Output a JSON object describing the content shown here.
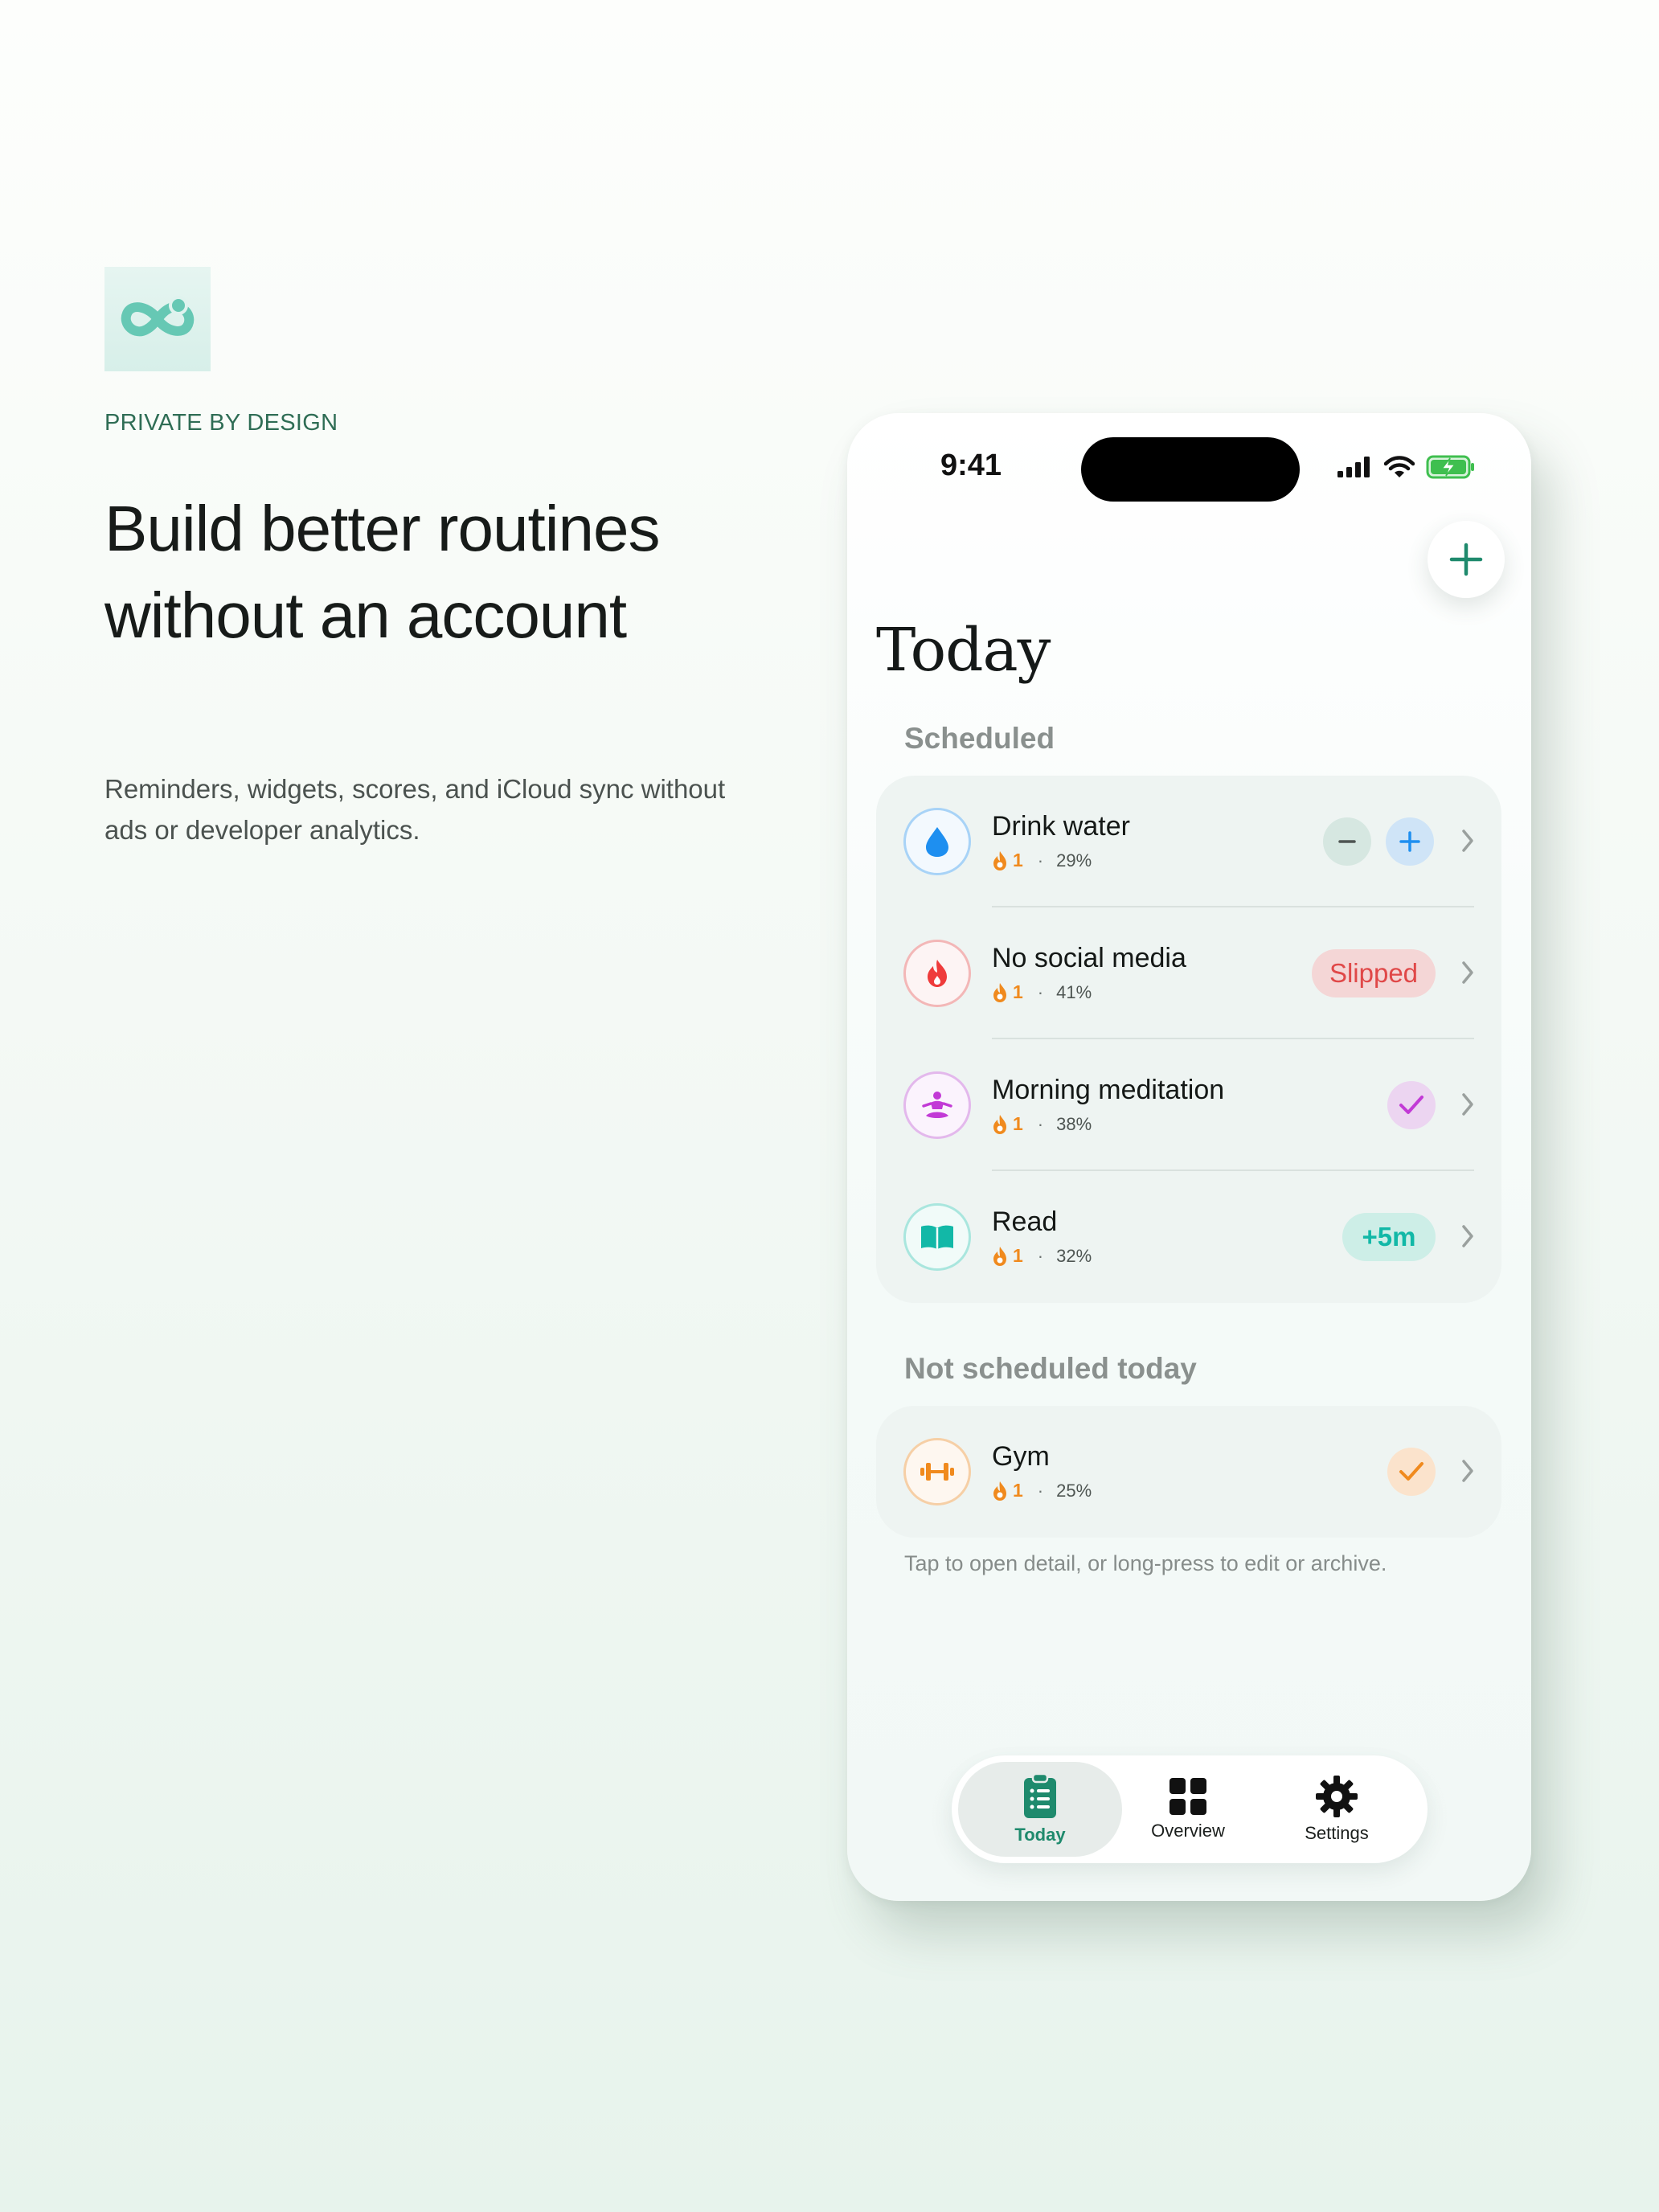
{
  "hero": {
    "eyebrow": "PRIVATE BY DESIGN",
    "headline_line1": "Build better routines",
    "headline_line2": "without an account",
    "subcopy": "Reminders, widgets, scores, and iCloud sync without ads or developer analytics."
  },
  "status_bar": {
    "time": "9:41"
  },
  "screen": {
    "title": "Today",
    "scheduled_label": "Scheduled",
    "not_scheduled_label": "Not scheduled today",
    "hint": "Tap to open detail, or long-press to edit or archive."
  },
  "scheduled_habits": [
    {
      "name": "Drink water",
      "streak": "1",
      "score": "29%",
      "icon": "water-drop-icon",
      "color": "#1e8ff0",
      "action": "stepper"
    },
    {
      "name": "No social media",
      "streak": "1",
      "score": "41%",
      "icon": "flame-icon",
      "color": "#ef3b3b",
      "action": "status",
      "action_label": "Slipped"
    },
    {
      "name": "Morning meditation",
      "streak": "1",
      "score": "38%",
      "icon": "meditation-icon",
      "color": "#c23ad6",
      "action": "check"
    },
    {
      "name": "Read",
      "streak": "1",
      "score": "32%",
      "icon": "book-icon",
      "color": "#12b8a7",
      "action": "increment",
      "action_label": "+5m"
    }
  ],
  "unscheduled_habits": [
    {
      "name": "Gym",
      "streak": "1",
      "score": "25%",
      "icon": "dumbbell-icon",
      "color": "#f08a1e",
      "action": "check"
    }
  ],
  "tabs": [
    {
      "label": "Today",
      "icon": "clipboard-list-icon",
      "active": true
    },
    {
      "label": "Overview",
      "icon": "grid-icon",
      "active": false
    },
    {
      "label": "Settings",
      "icon": "gear-icon",
      "active": false
    }
  ],
  "colors": {
    "accent": "#1f8a6d",
    "slipped_bg": "#f4d6d6",
    "slipped_text": "#e04848",
    "increment_bg": "#cdeee7",
    "increment_text": "#12b8a7"
  }
}
